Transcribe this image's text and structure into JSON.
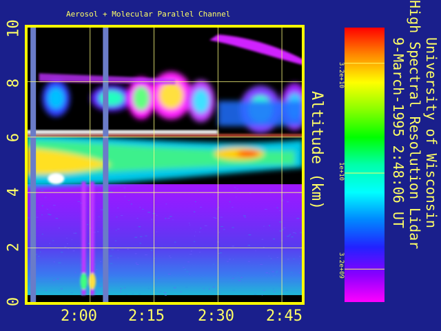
{
  "chart_data": {
    "type": "heatmap",
    "title": "Aerosol + Molecular Parallel Channel",
    "ylabel": "Altitude (km)",
    "ylim": [
      0,
      10
    ],
    "y_ticks": [
      "0",
      "2",
      "4",
      "6",
      "8",
      "10"
    ],
    "x_ticks": [
      "2:00",
      "2:15",
      "2:30",
      "2:45"
    ],
    "xlim_minutes": [
      105,
      170
    ],
    "x_tick_minutes": [
      120,
      135,
      150,
      165
    ],
    "grid": true,
    "layers": [
      {
        "altitude_range": [
          0.3,
          4.2
        ],
        "level": "low (3.2e+09 to 1e+10)"
      },
      {
        "altitude_range": [
          4.2,
          6.2
        ],
        "level": "high (above 1e+10)"
      },
      {
        "altitude_range": [
          6.2,
          8.5
        ],
        "level": "intermittent high"
      }
    ],
    "colorbar": {
      "ticks": [
        "3.2e+10",
        "1e+10",
        "3.2e+09"
      ],
      "colors": [
        "#ff0000",
        "#ff8800",
        "#ffff00",
        "#88ff00",
        "#00ff00",
        "#00ffaa",
        "#00ffff",
        "#0088ff",
        "#2222ff",
        "#8800ff",
        "#ff00ff"
      ]
    },
    "side_text": {
      "line1": "University of Wisconsin",
      "line2": "High Spectral Resolution Lidar",
      "line3": "9-March-1995   2:48:06 UT"
    },
    "data_gaps_minutes": [
      106,
      123
    ]
  }
}
